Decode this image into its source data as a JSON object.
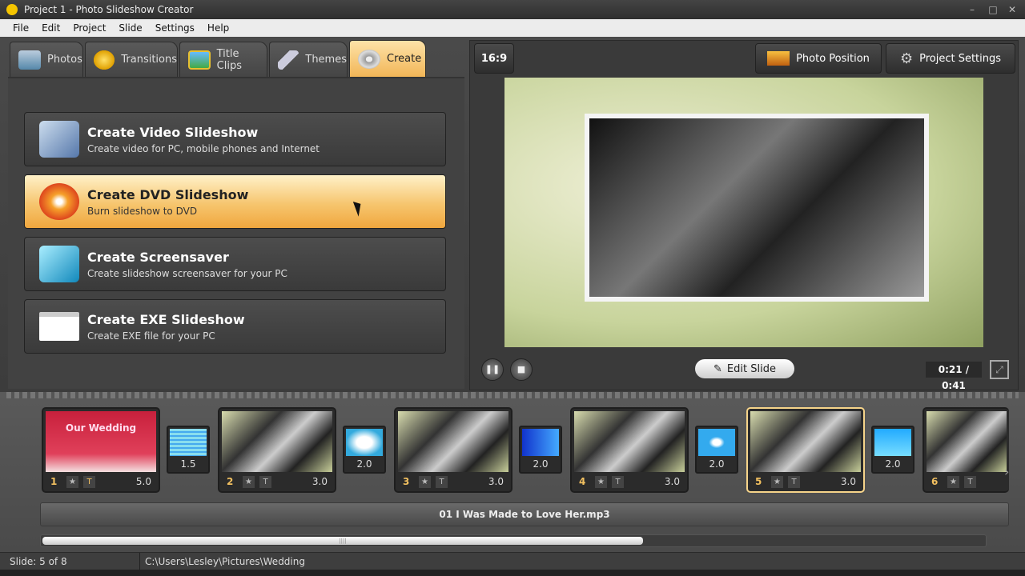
{
  "window": {
    "title": "Project 1 - Photo Slideshow Creator"
  },
  "menu": [
    "File",
    "Edit",
    "Project",
    "Slide",
    "Settings",
    "Help"
  ],
  "tabs": [
    {
      "label": "Photos",
      "icon": "camera-icon"
    },
    {
      "label": "Transitions",
      "icon": "star-icon"
    },
    {
      "label": "Title Clips",
      "icon": "picture-icon"
    },
    {
      "label": "Themes",
      "icon": "brush-icon"
    },
    {
      "label": "Create",
      "icon": "film-reel-icon",
      "active": true
    }
  ],
  "create_options": [
    {
      "title": "Create Video Slideshow",
      "subtitle": "Create video for PC, mobile phones and Internet"
    },
    {
      "title": "Create DVD Slideshow",
      "subtitle": "Burn slideshow to DVD",
      "active": true
    },
    {
      "title": "Create Screensaver",
      "subtitle": "Create slideshow screensaver for your PC"
    },
    {
      "title": "Create EXE Slideshow",
      "subtitle": "Create EXE file for your PC"
    }
  ],
  "preview": {
    "aspect": "16:9",
    "photo_position": "Photo Position",
    "project_settings": "Project Settings",
    "edit_slide": "Edit Slide",
    "time": "0:21 / 0:41"
  },
  "slides": [
    {
      "num": "1",
      "dur": "5.0",
      "caption": "Our Wedding"
    },
    {
      "num": "2",
      "dur": "3.0"
    },
    {
      "num": "3",
      "dur": "3.0"
    },
    {
      "num": "4",
      "dur": "3.0"
    },
    {
      "num": "5",
      "dur": "3.0",
      "selected": true
    },
    {
      "num": "6",
      "dur": ""
    }
  ],
  "transitions": [
    "1.5",
    "2.0",
    "2.0",
    "2.0",
    "2.0"
  ],
  "audio": "01 I Was Made to Love Her.mp3",
  "status": {
    "slide": "Slide: 5 of 8",
    "path": "C:\\Users\\Lesley\\Pictures\\Wedding"
  },
  "colors": {
    "accent": "#f2b657",
    "selected": "#f6d48a"
  }
}
